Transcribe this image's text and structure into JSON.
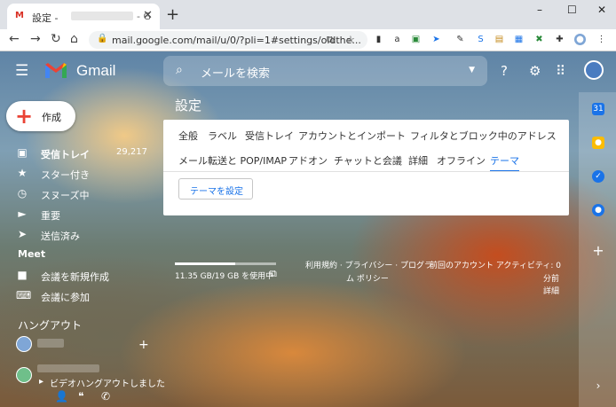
{
  "browser": {
    "tab_title": "設定 -",
    "tab_title_suffix": "- G",
    "new_tab": "+",
    "url": "mail.google.com/mail/u/0/?pli=1#settings/oldthe...",
    "window_min": "–",
    "window_max": "☐",
    "window_close": "✕"
  },
  "gmail": {
    "brand": "Gmail",
    "search_placeholder": "メールを検索",
    "compose": "作成",
    "nav": [
      {
        "label": "受信トレイ",
        "count": "29,217",
        "icon": "inbox-icon"
      },
      {
        "label": "スター付き",
        "icon": "star-icon"
      },
      {
        "label": "スヌーズ中",
        "icon": "clock-icon"
      },
      {
        "label": "重要",
        "icon": "label-important-icon"
      },
      {
        "label": "送信済み",
        "icon": "send-icon"
      }
    ],
    "meet_header": "Meet",
    "meet": [
      {
        "label": "会議を新規作成",
        "icon": "video-icon"
      },
      {
        "label": "会議に参加",
        "icon": "keyboard-icon"
      }
    ],
    "hangouts_header": "ハングアウト",
    "hangout_status": "ビデオハングアウトしました"
  },
  "settings": {
    "title": "設定",
    "tabs_row1": [
      "全般",
      "ラベル",
      "受信トレイ",
      "アカウントとインポート",
      "フィルタとブロック中のアドレス"
    ],
    "tabs_row2": [
      "メール転送と POP/IMAP",
      "アドオン",
      "チャットと会議",
      "詳細",
      "オフライン",
      "テーマ"
    ],
    "active_tab": "テーマ",
    "theme_button": "テーマを設定"
  },
  "footer": {
    "storage": "11.35 GB/19 GB を使用中",
    "storage_fraction": 0.6,
    "links_line1": "利用規約 · プライバシー · プログラ",
    "links_line2": "ム ポリシー",
    "activity_line1": "前回のアカウント アクティビティ: 0",
    "activity_line2": "分前",
    "activity_line3": "詳細"
  },
  "colors": {
    "accent": "#1a73e8",
    "gmail_red": "#ea4335"
  }
}
